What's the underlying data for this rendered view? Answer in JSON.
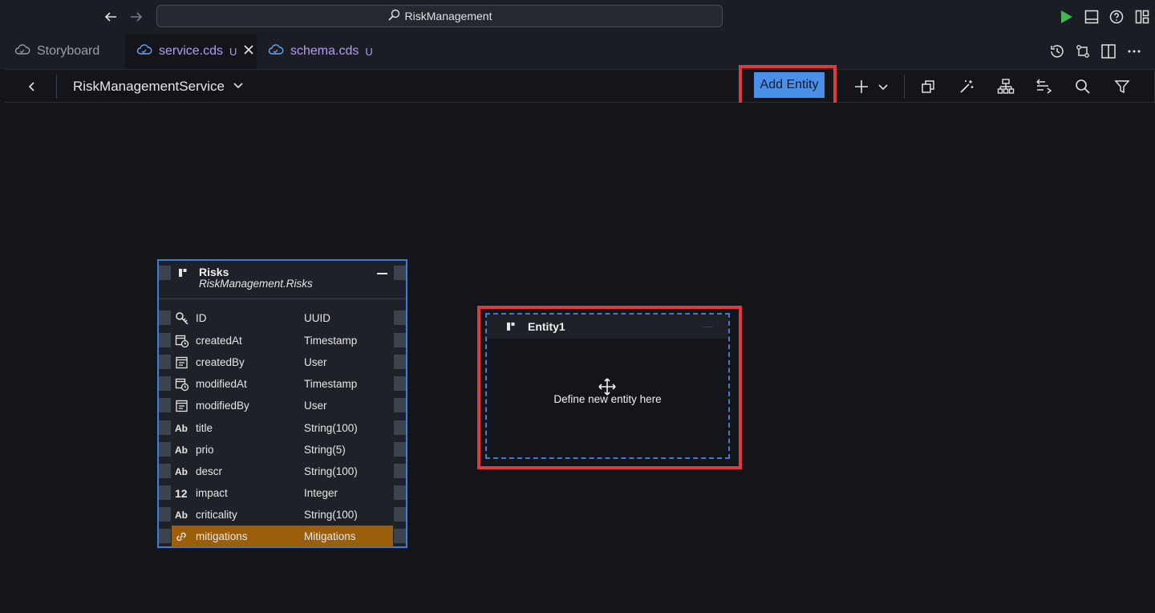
{
  "title_bar": {
    "search_text": "RiskManagement"
  },
  "tabs": [
    {
      "label": "Storyboard",
      "badge": ""
    },
    {
      "label": "service.cds",
      "badge": "U"
    },
    {
      "label": "schema.cds",
      "badge": "U"
    }
  ],
  "toolbar": {
    "service_name": "RiskManagementService",
    "add_entity_label": "Add Entity"
  },
  "risks_entity": {
    "name": "Risks",
    "qualified_name": "RiskManagement.Risks",
    "fields": [
      {
        "icon": "key-icon",
        "name": "ID",
        "type": "UUID"
      },
      {
        "icon": "calendar-clock-icon",
        "name": "createdAt",
        "type": "Timestamp"
      },
      {
        "icon": "user-card-icon",
        "name": "createdBy",
        "type": "User"
      },
      {
        "icon": "calendar-clock-icon",
        "name": "modifiedAt",
        "type": "Timestamp"
      },
      {
        "icon": "user-card-icon",
        "name": "modifiedBy",
        "type": "User"
      },
      {
        "icon": "text-type-icon",
        "glyph": "Ab",
        "name": "title",
        "type": "String(100)"
      },
      {
        "icon": "text-type-icon",
        "glyph": "Ab",
        "name": "prio",
        "type": "String(5)"
      },
      {
        "icon": "text-type-icon",
        "glyph": "Ab",
        "name": "descr",
        "type": "String(100)"
      },
      {
        "icon": "number-type-icon",
        "glyph": "12",
        "name": "impact",
        "type": "Integer"
      },
      {
        "icon": "text-type-icon",
        "glyph": "Ab",
        "name": "criticality",
        "type": "String(100)"
      },
      {
        "icon": "link-icon",
        "name": "mitigations",
        "type": "Mitigations",
        "selected": true
      }
    ]
  },
  "new_entity": {
    "name": "Entity1",
    "placeholder": "Define new entity here"
  },
  "colors": {
    "accent": "#4a90e8",
    "highlight_box": "#e0393e",
    "run_green": "#3fb950",
    "selected_row": "#9b5e0b",
    "tab_name_purple": "#b39df5"
  }
}
